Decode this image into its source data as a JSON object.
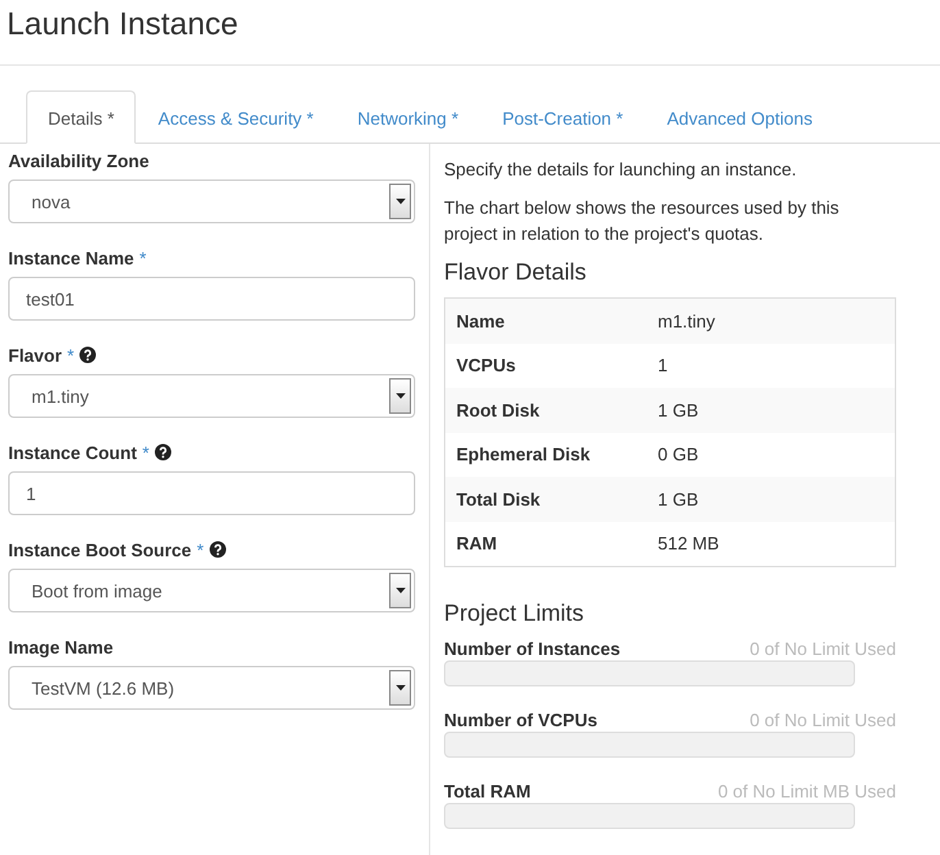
{
  "window": {
    "title": "Launch Instance"
  },
  "tabs": [
    {
      "label": "Details *",
      "selected": true
    },
    {
      "label": "Access & Security *",
      "selected": false
    },
    {
      "label": "Networking *",
      "selected": false
    },
    {
      "label": "Post-Creation *",
      "selected": false
    },
    {
      "label": "Advanced Options",
      "selected": false
    }
  ],
  "form": {
    "fields": [
      {
        "kind": "select",
        "label": "Availability Zone",
        "value": "nova"
      },
      {
        "kind": "input",
        "label": "Instance Name",
        "required_mark": "*",
        "value": "test01"
      },
      {
        "kind": "select",
        "label": "Flavor",
        "required_mark": "*",
        "help": true,
        "value": "m1.tiny"
      },
      {
        "kind": "input",
        "label": "Instance Count",
        "required_mark": "*",
        "help": true,
        "value": "1"
      },
      {
        "kind": "select",
        "label": "Instance Boot Source",
        "required_mark": "*",
        "help": true,
        "value": "Boot from image"
      },
      {
        "kind": "select",
        "label": "Image Name",
        "value": "TestVM (12.6 MB)"
      }
    ]
  },
  "description": [
    "Specify the details for launching an instance.",
    "The chart below shows the resources used by this project in relation to the project's quotas."
  ],
  "flavor_details": {
    "title": "Flavor Details",
    "rows": [
      {
        "name": "Name",
        "value": "m1.tiny"
      },
      {
        "name": "VCPUs",
        "value": "1"
      },
      {
        "name": "Root Disk",
        "value": "1 GB"
      },
      {
        "name": "Ephemeral Disk",
        "value": "0 GB"
      },
      {
        "name": "Total Disk",
        "value": "1 GB"
      },
      {
        "name": "RAM",
        "value": "512 MB"
      }
    ]
  },
  "project_limits": {
    "title": "Project Limits",
    "items": [
      {
        "label": "Number of Instances",
        "reading": "0 of No Limit Used",
        "level": 0
      },
      {
        "label": "Number of VCPUs",
        "reading": "0 of No Limit Used",
        "level": 0
      },
      {
        "label": "Total RAM",
        "reading": "0 of No Limit MB Used",
        "level": 0
      }
    ]
  }
}
